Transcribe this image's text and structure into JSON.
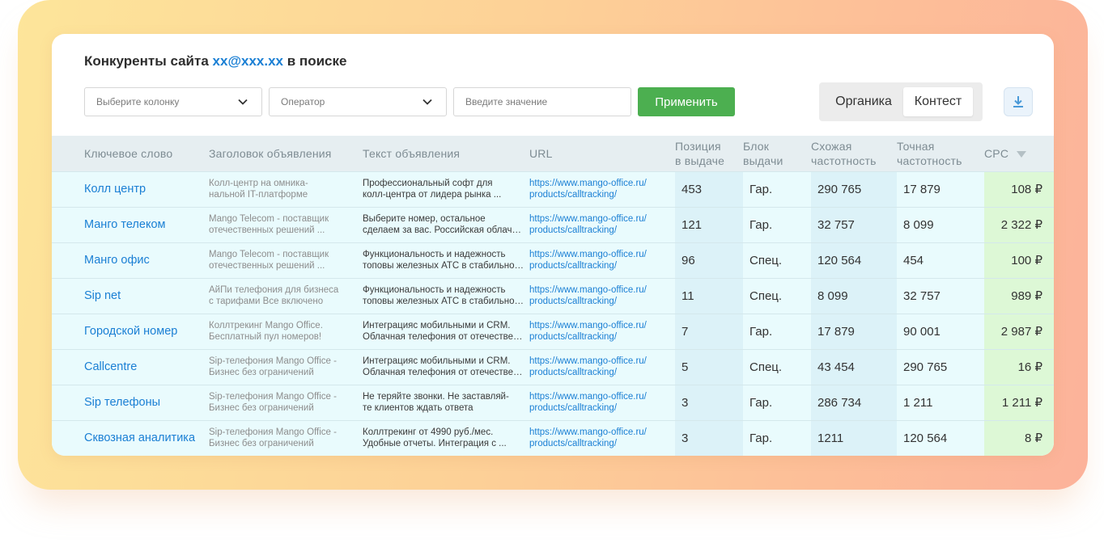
{
  "title": {
    "prefix": "Конкуренты сайта",
    "site": "xx@xxx.xx",
    "suffix": "в поиске"
  },
  "filters": {
    "column_placeholder": "Выберите колонку",
    "operator_placeholder": "Оператор",
    "value_placeholder": "Введите значение",
    "apply_label": "Применить"
  },
  "toggle": {
    "organic": "Органика",
    "context": "Контест",
    "selected": "Контест"
  },
  "download_icon": "download-icon",
  "colors": {
    "accent": "#1a7fd4",
    "apply": "#4caf50",
    "cpc_bg": "#ddf8d6",
    "row_bg": "#e9fbfd"
  },
  "table": {
    "headers": {
      "keyword": "Ключевое слово",
      "ad_title": "Заголовок объявления",
      "ad_text": "Текст объявления",
      "url": "URL",
      "position_1": "Позиция",
      "position_2": "в выдаче",
      "block_1": "Блок",
      "block_2": "выдачи",
      "similar_1": "Схожая",
      "similar_2": "частотность",
      "exact_1": "Точная",
      "exact_2": "частотность",
      "cpc": "CPC"
    },
    "rows": [
      {
        "keyword": "Колл центр",
        "ad_title_1": "Колл-центр на омника-",
        "ad_title_2": "нальной IT-платформе",
        "ad_text_1": "Профессиональный софт для",
        "ad_text_2": "колл-центра от лидера рынка ...",
        "url_1": "https://www.mango-office.ru/",
        "url_2": "products/calltracking/",
        "position": "453",
        "block": "Гар.",
        "similar": "290 765",
        "exact": "17 879",
        "cpc": "108 ₽"
      },
      {
        "keyword": "Манго телеком",
        "ad_title_1": "Mango Telecom - поставщик",
        "ad_title_2": "отечественных решений ...",
        "ad_text_1": "Выберите номер, остальное",
        "ad_text_2": "сделаем за вас. Российская облачная",
        "url_1": "https://www.mango-office.ru/",
        "url_2": "products/calltracking/",
        "position": "121",
        "block": "Гар.",
        "similar": "32 757",
        "exact": "8 099",
        "cpc": "2 322 ₽"
      },
      {
        "keyword": "Манго офис",
        "ad_title_1": "Mango Telecom - поставщик",
        "ad_title_2": "отечественных решений ...",
        "ad_text_1": "Функциональность и надежность",
        "ad_text_2": "топовы железных АТС в стабильности",
        "url_1": "https://www.mango-office.ru/",
        "url_2": "products/calltracking/",
        "position": "96",
        "block": "Спец.",
        "similar": "120 564",
        "exact": "454",
        "cpc": "100 ₽"
      },
      {
        "keyword": "Sip net",
        "ad_title_1": "АйПи телефония для бизнеса",
        "ad_title_2": "с тарифами Все включено",
        "ad_text_1": "Функциональность и надежность",
        "ad_text_2": "топовы железных АТС в стабильности",
        "url_1": "https://www.mango-office.ru/",
        "url_2": "products/calltracking/",
        "position": "11",
        "block": "Спец.",
        "similar": "8 099",
        "exact": "32 757",
        "cpc": "989 ₽"
      },
      {
        "keyword": "Городской номер",
        "ad_title_1": "Коллтрекинг Mango Office.",
        "ad_title_2": "Бесплатный пул номеров!",
        "ad_text_1": "Интеграцияс мобильными и CRM.",
        "ad_text_2": "Облачная телефония от отечественного",
        "url_1": "https://www.mango-office.ru/",
        "url_2": "products/calltracking/",
        "position": "7",
        "block": "Гар.",
        "similar": "17 879",
        "exact": "90 001",
        "cpc": "2 987 ₽"
      },
      {
        "keyword": "Callcentre",
        "ad_title_1": "Sip-телефония Mango Office -",
        "ad_title_2": "Бизнес без ограничений",
        "ad_text_1": "Интеграцияс мобильными и CRM.",
        "ad_text_2": "Облачная телефония от отечественного",
        "url_1": "https://www.mango-office.ru/",
        "url_2": "products/calltracking/",
        "position": "5",
        "block": "Спец.",
        "similar": "43 454",
        "exact": "290 765",
        "cpc": "16 ₽"
      },
      {
        "keyword": "Sip телефоны",
        "ad_title_1": "Sip-телефония Mango Office -",
        "ad_title_2": "Бизнес без ограничений",
        "ad_text_1": "Не теряйте звонки. Не заставляй-",
        "ad_text_2": "те клиентов ждать ответа",
        "url_1": "https://www.mango-office.ru/",
        "url_2": "products/calltracking/",
        "position": "3",
        "block": "Гар.",
        "similar": "286 734",
        "exact": "1 211",
        "cpc": "1 211 ₽"
      },
      {
        "keyword": "Сквозная аналитика",
        "ad_title_1": "Sip-телефония Mango Office -",
        "ad_title_2": "Бизнес без ограничений",
        "ad_text_1": "Коллтрекинг от 4990 руб./мес.",
        "ad_text_2": "Удобные отчеты. Интеграция с ...",
        "url_1": "https://www.mango-office.ru/",
        "url_2": "products/calltracking/",
        "position": "3",
        "block": "Гар.",
        "similar": "1211",
        "exact": "120 564",
        "cpc": "8 ₽"
      }
    ]
  }
}
